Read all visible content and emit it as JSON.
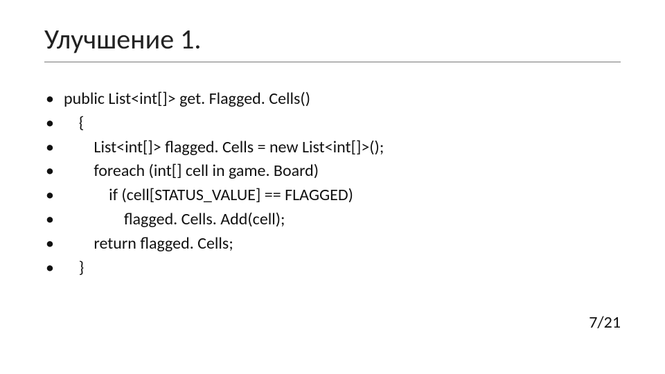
{
  "title": "Улучшение 1.",
  "bullets": [
    "public List<int[]> get. Flagged. Cells()",
    "    {",
    "        List<int[]> flagged. Cells = new List<int[]>();",
    "        foreach (int[] cell in game. Board)",
    "            if (cell[STATUS_VALUE] == FLAGGED)",
    "                flagged. Cells. Add(cell);",
    "        return flagged. Cells;",
    "    }"
  ],
  "page": "7/21",
  "bullet_char": "•"
}
